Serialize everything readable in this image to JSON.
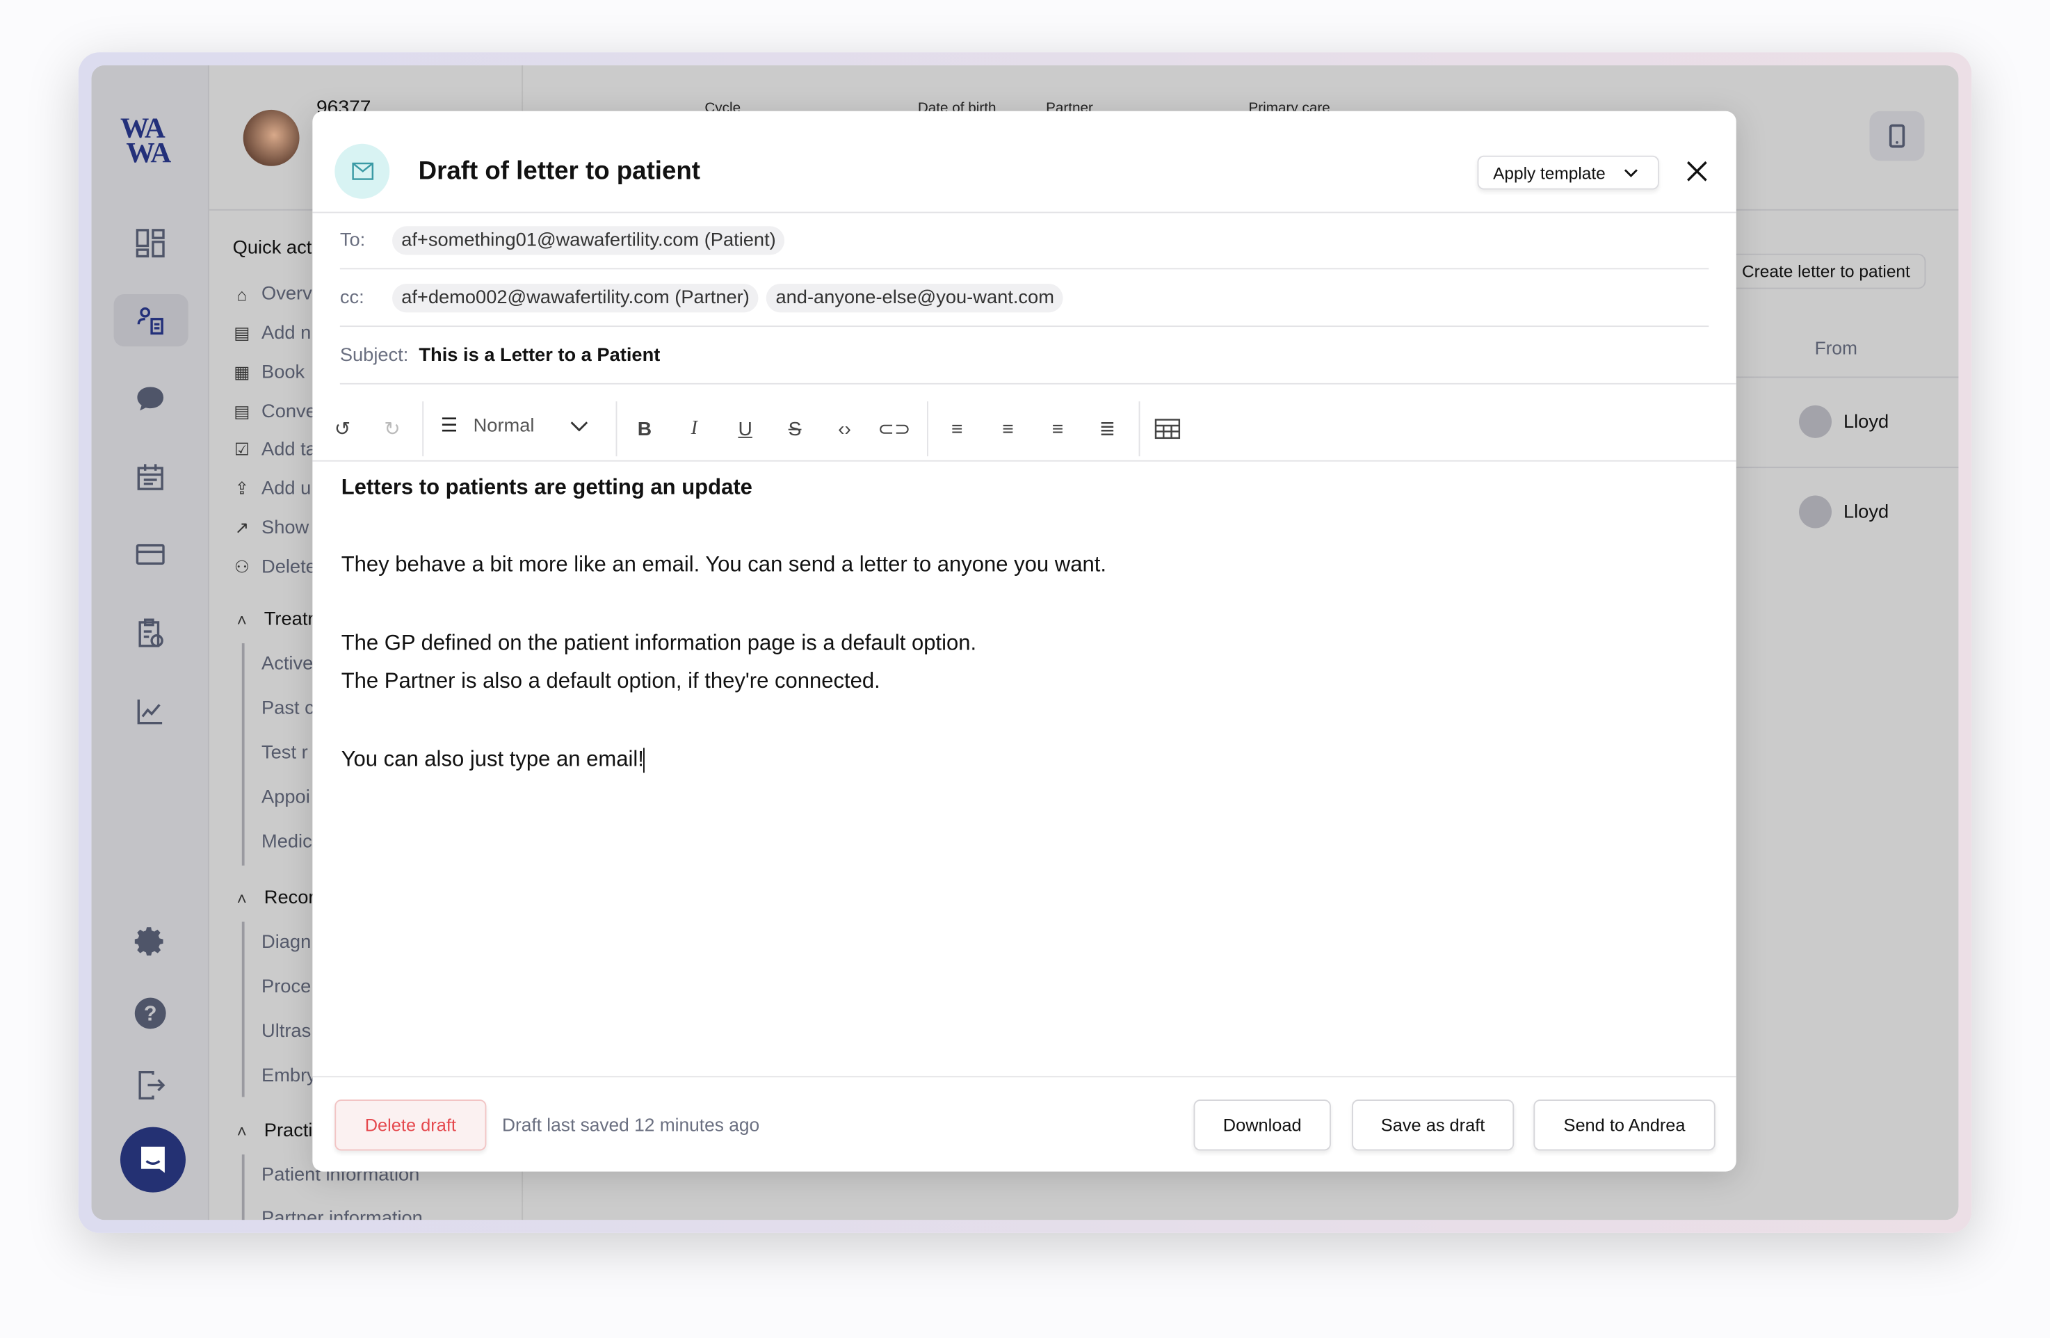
{
  "logo": "WA WA",
  "patient": {
    "id": "96377",
    "headers": [
      "Cycle",
      "Date of birth",
      "Partner",
      "Primary care"
    ]
  },
  "quick_actions": {
    "title": "Quick act",
    "items": [
      "Overv",
      "Add n",
      "Book ",
      "Conve",
      "Add ta",
      "Add u",
      "Show ",
      "Delete"
    ]
  },
  "treatment": {
    "title": "Treatm",
    "items": [
      "Active",
      "Past c",
      "Test r",
      "Appoi",
      "Medic"
    ]
  },
  "records": {
    "title": "Record",
    "items": [
      "Diagn",
      "Proce",
      "Ultras",
      "Embry"
    ]
  },
  "practice": {
    "title": "Practic",
    "items": [
      "Patient information",
      "Partner information"
    ]
  },
  "background": {
    "create_button": "Create letter to patient",
    "from_header": "From",
    "rows": [
      "Lloyd",
      "Lloyd"
    ]
  },
  "modal": {
    "title": "Draft of letter to patient",
    "apply_template": "Apply template",
    "to_label": "To:",
    "to": [
      "af+something01@wawafertility.com (Patient)"
    ],
    "cc_label": "cc:",
    "cc": [
      "af+demo002@wawafertility.com (Partner)",
      "and-anyone-else@you-want.com"
    ],
    "subject_label": "Subject:",
    "subject": "This is a Letter to a Patient",
    "text_style": "Normal",
    "body": {
      "heading": "Letters to patients are getting an update",
      "lines": [
        "",
        "They behave a bit more like an email. You can send a letter to anyone you want.",
        "",
        "The GP defined on the patient information page is a default option.",
        "The Partner is also a default option, if they're connected.",
        "",
        "You can also just type an email!"
      ]
    },
    "delete_draft": "Delete draft",
    "status": "Draft last saved 12 minutes ago",
    "download": "Download",
    "save_draft": "Save as draft",
    "send": "Send to Andrea"
  },
  "colors": {
    "brand": "#23307a",
    "danger": "#e5484d",
    "icon_bg": "#d8f3f3",
    "overlay": "#cbcbcb"
  }
}
